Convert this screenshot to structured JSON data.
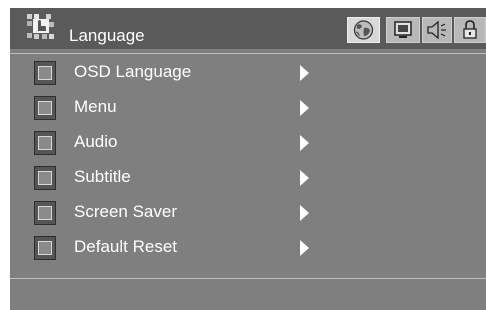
{
  "header": {
    "title": "Language",
    "icon": "language-menu-icon",
    "tabs": [
      {
        "icon": "globe-icon",
        "active": true
      },
      {
        "icon": "monitor-icon",
        "active": false
      },
      {
        "icon": "speaker-icon",
        "active": false
      },
      {
        "icon": "lock-icon",
        "active": false
      }
    ]
  },
  "menu": {
    "items": [
      {
        "label": "OSD Language"
      },
      {
        "label": "Menu"
      },
      {
        "label": "Audio"
      },
      {
        "label": "Subtitle"
      },
      {
        "label": "Screen Saver"
      },
      {
        "label": "Default Reset"
      }
    ]
  },
  "colors": {
    "panel": "#7f7f7f",
    "header": "#5a5a5a",
    "text": "#ffffff",
    "active_tab": "#d8d8d8",
    "inactive_tab": "#b8b8b8"
  }
}
